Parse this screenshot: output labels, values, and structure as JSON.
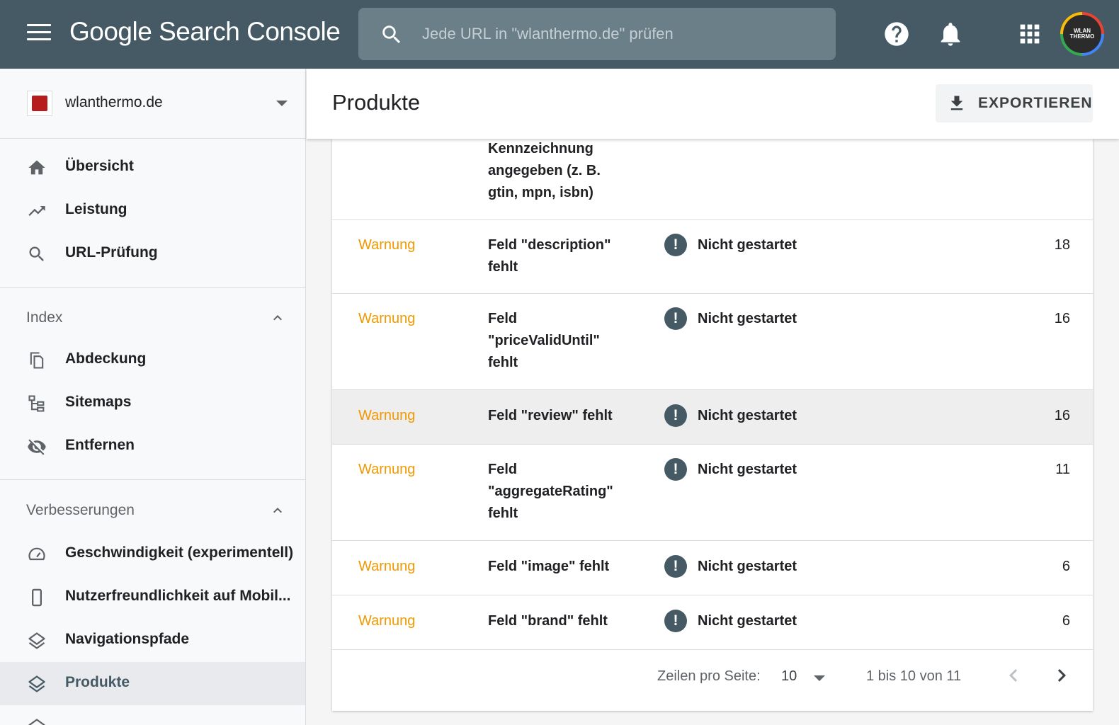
{
  "app": {
    "title": "Google Search Console",
    "search_placeholder": "Jede URL in \"wlanthermo.de\" prüfen",
    "avatar_text": "WLAN THERMO"
  },
  "sidebar": {
    "property": "wlanthermo.de",
    "items_top": [
      {
        "label": "Übersicht",
        "icon": "home-icon"
      },
      {
        "label": "Leistung",
        "icon": "trending-up-icon"
      },
      {
        "label": "URL-Prüfung",
        "icon": "search-icon"
      }
    ],
    "section_index": {
      "label": "Index",
      "items": [
        {
          "label": "Abdeckung",
          "icon": "pages-icon"
        },
        {
          "label": "Sitemaps",
          "icon": "sitemap-icon"
        },
        {
          "label": "Entfernen",
          "icon": "eye-off-icon"
        }
      ]
    },
    "section_improvements": {
      "label": "Verbesserungen",
      "items": [
        {
          "label": "Geschwindigkeit (experimentell)",
          "icon": "speedometer-icon"
        },
        {
          "label": "Nutzerfreundlichkeit auf Mobil...",
          "icon": "phone-icon"
        },
        {
          "label": "Navigationspfade",
          "icon": "layers-icon"
        },
        {
          "label": "Produkte",
          "icon": "layers-icon",
          "active": true
        }
      ]
    }
  },
  "main": {
    "title": "Produkte",
    "export_label": "EXPORTIEREN"
  },
  "table": {
    "partial_row_name": "Kennzeichnung angegeben (z. B. gtin, mpn, isbn)",
    "rows": [
      {
        "type": "Warnung",
        "name": "Feld \"description\" fehlt",
        "status": "Nicht gestartet",
        "count": "18"
      },
      {
        "type": "Warnung",
        "name": "Feld \"priceValidUntil\" fehlt",
        "status": "Nicht gestartet",
        "count": "16"
      },
      {
        "type": "Warnung",
        "name": "Feld \"review\" fehlt",
        "status": "Nicht gestartet",
        "count": "16"
      },
      {
        "type": "Warnung",
        "name": "Feld \"aggregateRating\" fehlt",
        "status": "Nicht gestartet",
        "count": "11"
      },
      {
        "type": "Warnung",
        "name": "Feld \"image\" fehlt",
        "status": "Nicht gestartet",
        "count": "6"
      },
      {
        "type": "Warnung",
        "name": "Feld \"brand\" fehlt",
        "status": "Nicht gestartet",
        "count": "6"
      }
    ],
    "status_icon_glyph": "!"
  },
  "pagination": {
    "rows_per_page_label": "Zeilen pro Seite:",
    "rows_per_page": "10",
    "range": "1 bis 10 von 11"
  },
  "colors": {
    "topbar": "#455a64",
    "warning": "#f29900",
    "status_icon": "#455a64"
  }
}
